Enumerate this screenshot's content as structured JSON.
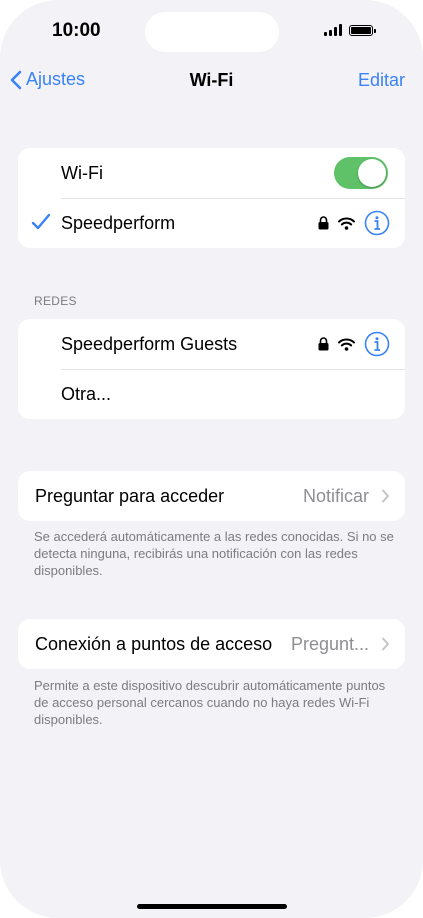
{
  "status_bar": {
    "time": "10:00"
  },
  "nav": {
    "back_label": "Ajustes",
    "title": "Wi-Fi",
    "edit_label": "Editar"
  },
  "wifi_group": {
    "toggle_label": "Wi-Fi",
    "toggle_on": true,
    "connected_network": "Speedperform"
  },
  "networks": {
    "header": "REDES",
    "items": [
      {
        "name": "Speedperform Guests"
      },
      {
        "name": "Otra..."
      }
    ]
  },
  "ask_to_join": {
    "label": "Preguntar para acceder",
    "value": "Notificar",
    "footnote": "Se accederá automáticamente a las redes conocidas. Si no se detecta ninguna, recibirás una notificación con las redes disponibles."
  },
  "hotspot": {
    "label": "Conexión a puntos de acceso",
    "value": "Pregunt...",
    "footnote": "Permite a este dispositivo descubrir automáticamente puntos de acceso personal cercanos cuando no haya redes Wi-Fi disponibles."
  },
  "colors": {
    "accent": "#3a82f7",
    "toggle_on": "#5fc168",
    "background": "#f2f2f7"
  }
}
